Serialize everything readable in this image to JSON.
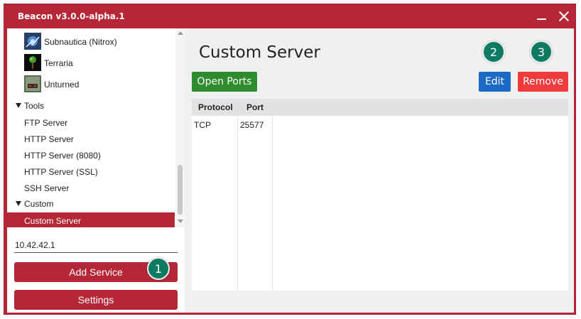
{
  "window": {
    "title": "Beacon v3.0.0-alpha.1"
  },
  "sidebar": {
    "games": [
      {
        "label": "Subnautica (Nitrox)",
        "icon": "subnautica-icon"
      },
      {
        "label": "Terraria",
        "icon": "terraria-icon"
      },
      {
        "label": "Unturned",
        "icon": "unturned-icon"
      }
    ],
    "tools": {
      "label": "Tools",
      "items": [
        "FTP Server",
        "HTTP Server",
        "HTTP Server (8080)",
        "HTTP Server (SSL)",
        "SSH Server"
      ]
    },
    "custom": {
      "label": "Custom",
      "items": [
        "Custom Server"
      ]
    },
    "address": "10.42.42.1",
    "add_service_label": "Add Service",
    "settings_label": "Settings"
  },
  "main": {
    "title": "Custom Server",
    "open_ports_label": "Open Ports",
    "edit_label": "Edit",
    "remove_label": "Remove",
    "table": {
      "columns": [
        "Protocol",
        "Port"
      ],
      "rows": [
        {
          "protocol": "TCP",
          "port": "25577"
        }
      ]
    }
  },
  "badges": [
    "1",
    "2",
    "3"
  ],
  "colors": {
    "accent": "#b52636",
    "open_ports": "#2e8b2e",
    "edit": "#1b6ac7",
    "remove": "#ef3b3b",
    "badge": "#0e7a61"
  }
}
